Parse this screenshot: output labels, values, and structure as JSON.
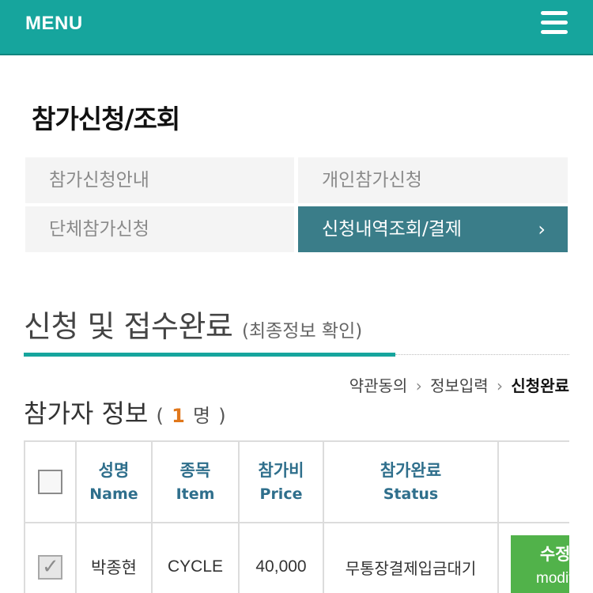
{
  "header": {
    "menu_label": "MENU",
    "hamburger_icon": "hamburger-menu-icon",
    "background_color": "#16a59d"
  },
  "page_title": "참가신청/조회",
  "tabs": [
    {
      "label": "참가신청안내",
      "active": false
    },
    {
      "label": "개인참가신청",
      "active": false
    },
    {
      "label": "단체참가신청",
      "active": false
    },
    {
      "label": "신청내역조회/결제",
      "active": true,
      "chevron": "›"
    }
  ],
  "section": {
    "title": "신청 및 접수완료",
    "subtitle": "(최종정보 확인)"
  },
  "steps": {
    "items": [
      "약관동의",
      "정보입력",
      "신청완료"
    ],
    "separator": "›",
    "current_index": 2
  },
  "participants": {
    "label": "참가자 정보",
    "open": "(",
    "count": "1",
    "unit": "명",
    "close": ")"
  },
  "table": {
    "headers": [
      {
        "ko": "",
        "en": ""
      },
      {
        "ko": "성명",
        "en": "Name"
      },
      {
        "ko": "종목",
        "en": "Item"
      },
      {
        "ko": "참가비",
        "en": "Price"
      },
      {
        "ko": "참가완료",
        "en": "Status"
      },
      {
        "ko": "",
        "en": ""
      }
    ],
    "rows": [
      {
        "checked": true,
        "name": "박종현",
        "item": "CYCLE",
        "price": "40,000",
        "status": "무통장결제입금대기",
        "action_ko": "수정/",
        "action_en": "modify"
      }
    ]
  },
  "colors": {
    "accent": "#16a59d",
    "active_tab": "#3a7d89",
    "header_text": "#2f6f8c",
    "count": "#e0771b",
    "modify_button": "#51b24a"
  }
}
